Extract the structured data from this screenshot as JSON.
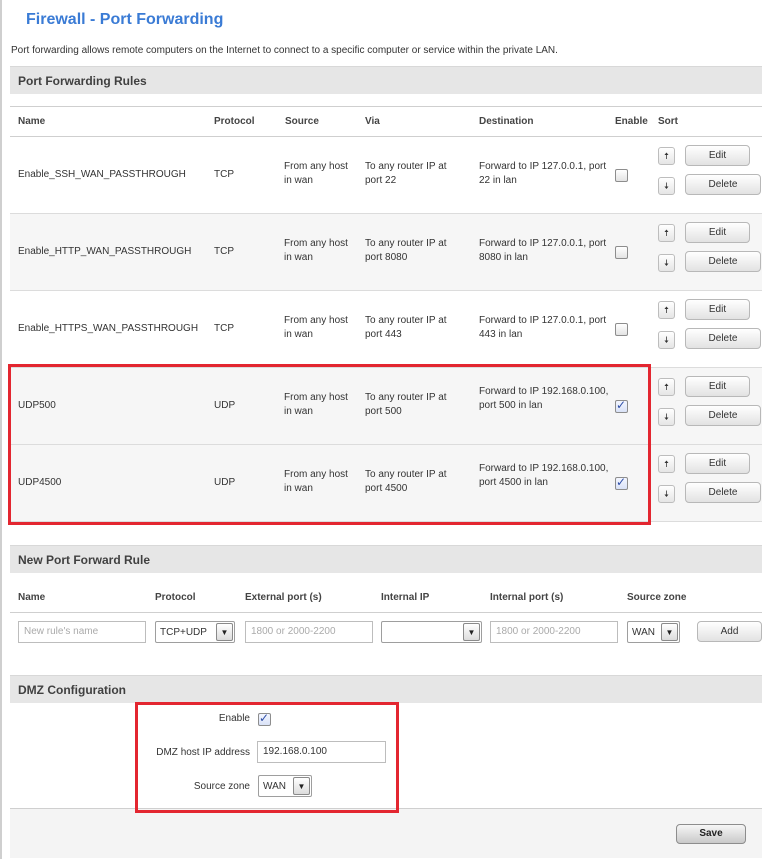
{
  "page": {
    "title": "Firewall - Port Forwarding",
    "intro": "Port forwarding allows remote computers on the Internet to connect to a specific computer or service within the private LAN."
  },
  "rules_section": {
    "title": "Port Forwarding Rules",
    "columns": [
      "Name",
      "Protocol",
      "Source",
      "Via",
      "Destination",
      "Enable",
      "Sort"
    ],
    "edit_label": "Edit",
    "delete_label": "Delete",
    "sort_up_glyph": "🠅",
    "sort_down_glyph": "🠇",
    "rules": [
      {
        "name": "Enable_SSH_WAN_PASSTHROUGH",
        "protocol": "TCP",
        "source": "From any host in wan",
        "via": "To any router IP at port 22",
        "destination": "Forward to IP 127.0.0.1, port 22 in lan",
        "enabled": false
      },
      {
        "name": "Enable_HTTP_WAN_PASSTHROUGH",
        "protocol": "TCP",
        "source": "From any host in wan",
        "via": "To any router IP at port 8080",
        "destination": "Forward to IP 127.0.0.1, port 8080 in lan",
        "enabled": false
      },
      {
        "name": "Enable_HTTPS_WAN_PASSTHROUGH",
        "protocol": "TCP",
        "source": "From any host in wan",
        "via": "To any router IP at port 443",
        "destination": "Forward to IP 127.0.0.1, port 443 in lan",
        "enabled": false
      },
      {
        "name": "UDP500",
        "protocol": "UDP",
        "source": "From any host in wan",
        "via": "To any router IP at port 500",
        "destination": "Forward to IP 192.168.0.100, port 500 in lan",
        "enabled": true
      },
      {
        "name": "UDP4500",
        "protocol": "UDP",
        "source": "From any host in wan",
        "via": "To any router IP at port 4500",
        "destination": "Forward to IP 192.168.0.100, port 4500 in lan",
        "enabled": true
      }
    ]
  },
  "new_rule_section": {
    "title": "New Port Forward Rule",
    "columns": [
      "Name",
      "Protocol",
      "External port (s)",
      "Internal IP",
      "Internal port (s)",
      "Source zone"
    ],
    "name_placeholder": "New rule's name",
    "protocol_value": "TCP+UDP",
    "external_port_placeholder": "1800 or 2000-2200",
    "internal_ip_value": "",
    "internal_port_placeholder": "1800 or 2000-2200",
    "source_zone_value": "WAN",
    "add_label": "Add"
  },
  "dmz_section": {
    "title": "DMZ Configuration",
    "enable_label": "Enable",
    "enabled": true,
    "host_ip_label": "DMZ host IP address",
    "host_ip_value": "192.168.0.100",
    "source_zone_label": "Source zone",
    "source_zone_value": "WAN"
  },
  "footer": {
    "save_label": "Save"
  },
  "colors": {
    "title_blue": "#3a7bd5",
    "highlight_red": "#e32630",
    "check_blue": "#2f4fa8"
  }
}
